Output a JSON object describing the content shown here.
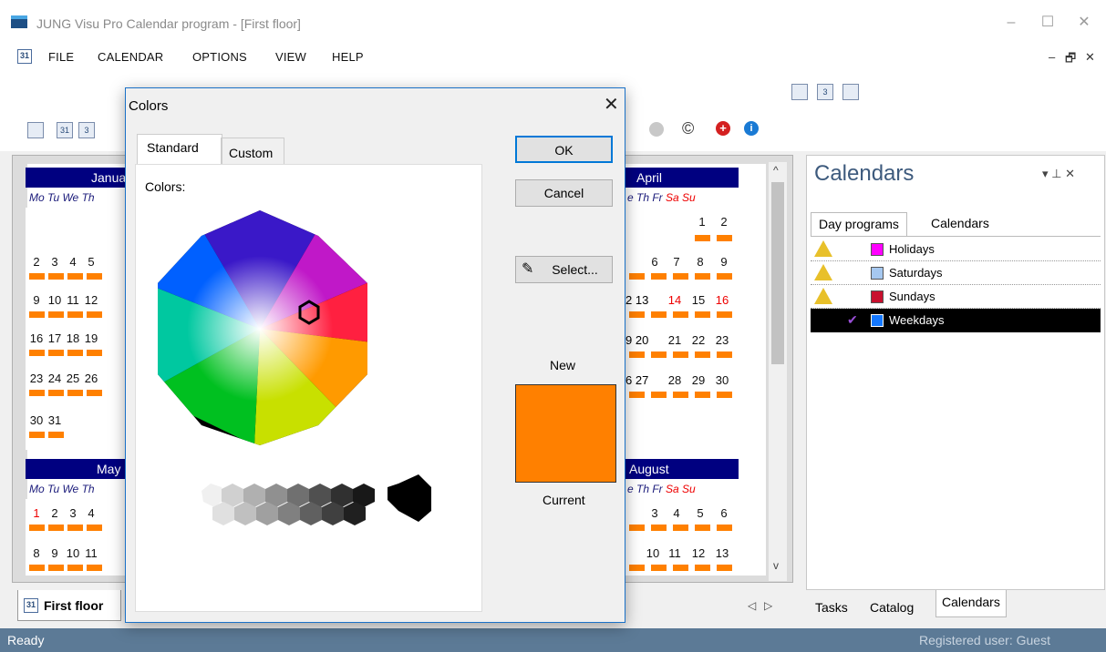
{
  "window": {
    "title": "JUNG Visu Pro Calendar program - [First floor]",
    "minimize": "–",
    "maximize": "☐",
    "close": "✕"
  },
  "menubar": {
    "items": [
      "FILE",
      "CALENDAR",
      "OPTIONS",
      "VIEW",
      "HELP"
    ],
    "mdi_min": "–",
    "mdi_restore": "🗗",
    "mdi_close": "✕"
  },
  "calendar_view": {
    "months": [
      {
        "name": "Janua",
        "head": "Mo Tu We Th",
        "rows": [
          [
            "",
            "",
            "",
            ""
          ],
          [
            "2",
            "3",
            "4",
            "5"
          ],
          [
            "9",
            "10",
            "11",
            "12"
          ],
          [
            "16",
            "17",
            "18",
            "19"
          ],
          [
            "23",
            "24",
            "25",
            "26"
          ],
          [
            "30",
            "31",
            "",
            ""
          ]
        ]
      },
      {
        "name": "April",
        "head": "e Th Fr Sa Su",
        "rows": [
          [
            "",
            "",
            "",
            "1",
            "2"
          ],
          [
            "6",
            "7",
            "8",
            "9",
            ""
          ],
          [
            "2 13",
            "14",
            "15",
            "16",
            ""
          ],
          [
            "9 20",
            "21",
            "22",
            "23",
            ""
          ],
          [
            "6 27",
            "28",
            "29",
            "30",
            ""
          ]
        ]
      },
      {
        "name": "May",
        "head": "Mo Tu We Th",
        "rows": [
          [
            "1",
            "2",
            "3",
            "4"
          ],
          [
            "8",
            "9",
            "10",
            "11"
          ]
        ]
      },
      {
        "name": "August",
        "head": "e Th Fr Sa Su",
        "rows": [
          [
            "3",
            "4",
            "5",
            "6"
          ],
          [
            "10",
            "11",
            "12",
            "13"
          ]
        ]
      }
    ],
    "doc_tab": "First floor"
  },
  "right_panel": {
    "title": "Calendars",
    "pin": "▾  ⊥  ✕",
    "tabs": [
      "Day programs",
      "Calendars"
    ],
    "rows": [
      {
        "label": "Holidays",
        "color": "#ff00ff",
        "warn": true
      },
      {
        "label": "Saturdays",
        "color": "#a6c8f0",
        "warn": true
      },
      {
        "label": "Sundays",
        "color": "#c8102e",
        "warn": true
      },
      {
        "label": "Weekdays",
        "color": "#1478ff",
        "warn": false,
        "check": "✔"
      }
    ],
    "bottom_tabs": [
      "Tasks",
      "Catalog",
      "Calendars"
    ]
  },
  "status": {
    "left": "Ready",
    "right": "Registered user: Guest"
  },
  "dialog": {
    "title": "Colors",
    "close": "✕",
    "tabs": [
      "Standard",
      "Custom"
    ],
    "colors_label": "Colors:",
    "ok": "OK",
    "cancel": "Cancel",
    "select": "Select...",
    "new_label": "New",
    "current_label": "Current",
    "new_color": "#ff8000"
  }
}
